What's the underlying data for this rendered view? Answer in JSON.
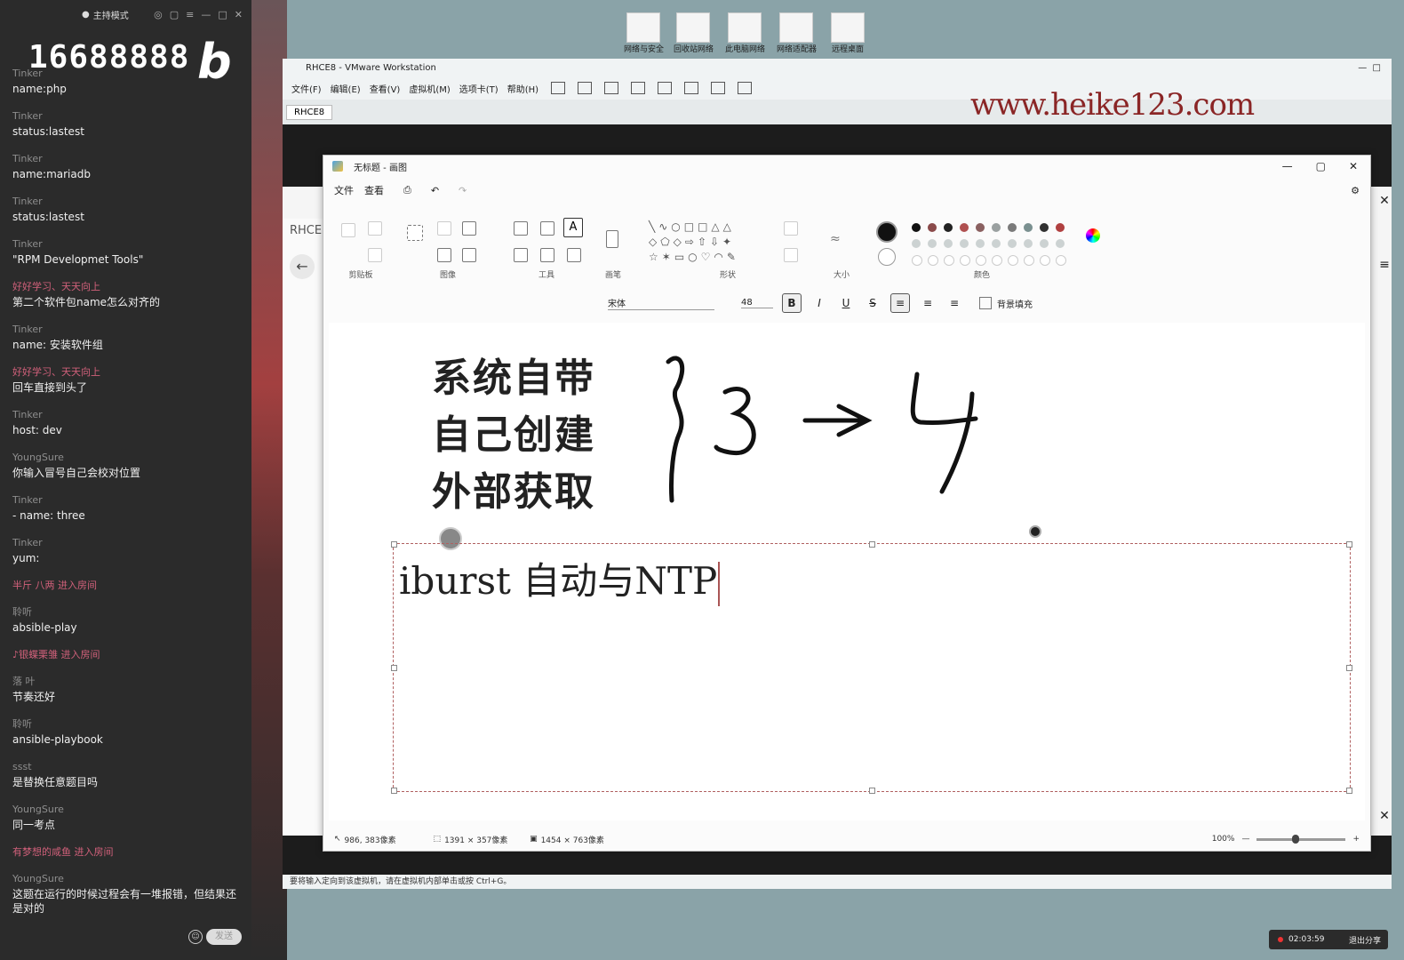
{
  "chat": {
    "mode_label": "主持模式",
    "overlay_number": "16688888",
    "overlay_logo": "bilibili",
    "messages": [
      {
        "user": "Tinker",
        "text": "name:php",
        "pink": false
      },
      {
        "user": "Tinker",
        "text": "status:lastest",
        "pink": false
      },
      {
        "user": "Tinker",
        "text": "name:mariadb",
        "pink": false
      },
      {
        "user": "Tinker",
        "text": "status:lastest",
        "pink": false
      },
      {
        "user": "Tinker",
        "text": "\"RPM Developmet Tools\"",
        "pink": false
      },
      {
        "user": "好好学习、天天向上",
        "text": "第二个软件包name怎么对齐的",
        "pink": true
      },
      {
        "user": "Tinker",
        "text": "name: 安装软件组",
        "pink": false
      },
      {
        "user": "好好学习、天天向上",
        "text": "回车直接到头了",
        "pink": true
      },
      {
        "user": "Tinker",
        "text": "host: dev",
        "pink": false
      },
      {
        "user": "YoungSure",
        "text": "你输入冒号自己会校对位置",
        "pink": false
      },
      {
        "user": "Tinker",
        "text": "- name: three",
        "pink": false
      },
      {
        "user": "Tinker",
        "text": "yum:",
        "pink": false
      }
    ],
    "system_1": "半斤 八两 进入房间",
    "messages_2": [
      {
        "user": "聆听",
        "text": "absible-play",
        "pink": false
      }
    ],
    "system_2": "♪银蝶栗雏 进入房间",
    "messages_3": [
      {
        "user": "落 叶",
        "text": "节奏还好",
        "pink": false
      },
      {
        "user": "聆听",
        "text": "ansible-playbook",
        "pink": false
      },
      {
        "user": "ssst",
        "text": "是替换任意题目吗",
        "pink": false
      },
      {
        "user": "YoungSure",
        "text": "同一考点",
        "pink": false
      }
    ],
    "system_3": "有梦想的咸鱼 进入房间",
    "last_message": {
      "user": "YoungSure",
      "text": "这题在运行的时候过程会有一堆报错，但结果还是对的"
    },
    "send_label": "发送"
  },
  "desktop_icons": [
    "网络与安全",
    "回收站网络",
    "此电脑网络",
    "网络适配器",
    "远程桌面"
  ],
  "vmware": {
    "title": "RHCE8 - VMware Workstation",
    "menu": [
      "文件(F)",
      "编辑(E)",
      "查看(V)",
      "虚拟机(M)",
      "选项卡(T)",
      "帮助(H)"
    ],
    "tab": "RHCE8",
    "guest_label": "RHCE",
    "status_text": "要将输入定向到该虚拟机，请在虚拟机内部单击或按 Ctrl+G。"
  },
  "watermark": "www.heike123.com",
  "paint": {
    "title": "无标题 - 画图",
    "menu": [
      "文件",
      "查看"
    ],
    "groups": [
      "剪贴板",
      "图像",
      "工具",
      "画笔",
      "形状",
      "大小",
      "颜色"
    ],
    "font": "宋体",
    "size": "48",
    "fill_label": "背景填充",
    "canvas_lines": [
      "系统自带",
      "自己创建",
      "外部获取"
    ],
    "handwritten": "}3→4",
    "typed_text": "iburst 自动与NTP",
    "status": {
      "cursor": "986, 383像素",
      "selection": "1391 × 357像素",
      "canvas_size": "1454 × 763像素",
      "zoom": "100%"
    },
    "colors": [
      "#111111",
      "#8a4a4a",
      "#222222",
      "#b05050",
      "#8a6060",
      "#9aa0a0",
      "#7a7a7a",
      "#7a9090",
      "#303030",
      "#b04040"
    ]
  },
  "share": {
    "timer": "02:03:59",
    "exit_label": "退出分享"
  }
}
